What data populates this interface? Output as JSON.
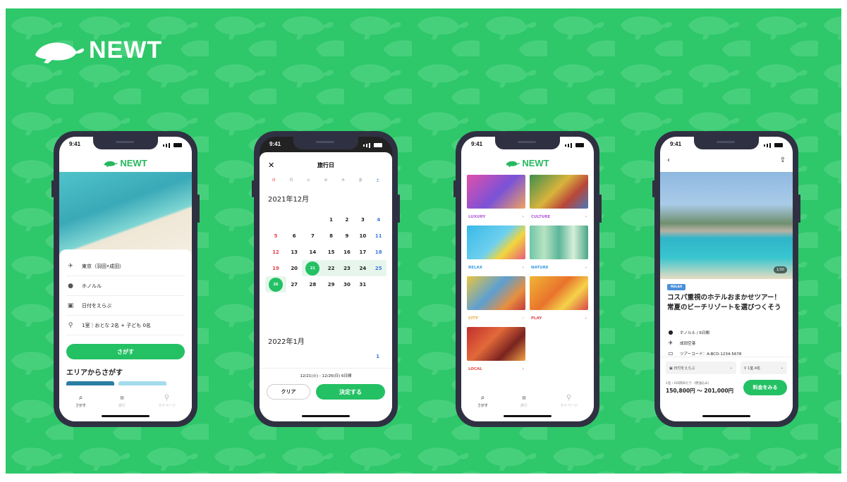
{
  "brand": {
    "name": "NEWT"
  },
  "colors": {
    "background": "#2ec76a",
    "accent": "#23c164",
    "phone_frame": "#2f3142",
    "sunday": "#e4414a",
    "saturday": "#3b7ae0"
  },
  "phone1": {
    "time": "9:41",
    "logo": "NEWT",
    "fields": [
      {
        "icon": "plane-icon",
        "text": "東京（羽田•成田）"
      },
      {
        "icon": "pin-icon",
        "text": "ホノルル"
      },
      {
        "icon": "calendar-icon",
        "text": "日付をえらぶ"
      },
      {
        "icon": "person-icon",
        "text": "1室｜おとな 2名 + 子ども 0名"
      }
    ],
    "search_button": "さがす",
    "area_title": "エリアからさがす",
    "tabs": [
      {
        "icon": "search-icon",
        "label": "さがす",
        "active": true
      },
      {
        "icon": "suitcase-icon",
        "label": "旅行",
        "active": false
      },
      {
        "icon": "user-icon",
        "label": "マイページ",
        "active": false
      }
    ]
  },
  "phone2": {
    "time": "9:41",
    "title": "旅行日",
    "close": "✕",
    "weekdays": [
      "日",
      "月",
      "火",
      "水",
      "木",
      "金",
      "土"
    ],
    "month1": "2021年12月",
    "month1_days": [
      "",
      "",
      "",
      "1",
      "2",
      "3",
      "4",
      "5",
      "6",
      "7",
      "8",
      "9",
      "10",
      "11",
      "12",
      "13",
      "14",
      "15",
      "16",
      "17",
      "18",
      "19",
      "20",
      "21",
      "22",
      "23",
      "24",
      "25",
      "26",
      "27",
      "28",
      "29",
      "30",
      "31",
      ""
    ],
    "selected_start": "21",
    "selected_end": "26",
    "month2": "2022年1月",
    "month2_days": [
      "",
      "",
      "",
      "",
      "",
      "",
      "1"
    ],
    "range_label": "12/21(火) - 12/26(日)  6日間",
    "clear_button": "クリア",
    "confirm_button": "決定する"
  },
  "phone3": {
    "time": "9:41",
    "logo": "NEWT",
    "categories": [
      {
        "label": "LUXURY",
        "color": "#b05ad6",
        "img": "linear-gradient(135deg,#e14fa9,#7a52d8 55%,#f2a25f)"
      },
      {
        "label": "CULTURE",
        "color": "#b05ad6",
        "img": "linear-gradient(135deg,#3d8f4d,#d9b33d 45%,#b94639 70%,#4b77b8)"
      },
      {
        "label": "RELAX",
        "color": "#3b9de0",
        "img": "linear-gradient(135deg,#39b9e8,#6ed0ee 50%,#f2d63c 70%,#e85a7e)"
      },
      {
        "label": "NATURE",
        "color": "#3b9de0",
        "img": "linear-gradient(90deg,#6fc6a8,#b9e3c2 25%,#5bb59a 50%,#d6efd9 75%,#4aa587)"
      },
      {
        "label": "CITY",
        "color": "#e8a830",
        "img": "linear-gradient(135deg,#e8c542,#5d9fd1 45%,#e88f3e 75%,#c2393b)"
      },
      {
        "label": "PLAY",
        "color": "#e24b4b",
        "img": "linear-gradient(135deg,#f0b535,#e9732c 45%,#f5d24a 70%,#d84747)"
      },
      {
        "label": "LOCAL",
        "color": "#e24b4b",
        "img": "linear-gradient(135deg,#c22f2f,#e2693a 40%,#7a2320 70%,#f0a144)"
      }
    ],
    "tabs": [
      {
        "icon": "search-icon",
        "label": "さがす",
        "active": true
      },
      {
        "icon": "suitcase-icon",
        "label": "旅行",
        "active": false
      },
      {
        "icon": "user-icon",
        "label": "マイページ",
        "active": false
      }
    ]
  },
  "phone4": {
    "time": "9:41",
    "photo_count": "1/30",
    "tag": "RELAX",
    "title": "コスパ重視のホテルおまかせツアー！常夏のビーチリゾートを選びつくそう",
    "meta": [
      {
        "icon": "pin-icon",
        "text": "ホノルル / 6日間"
      },
      {
        "icon": "plane-icon",
        "text": "成田空港"
      },
      {
        "icon": "code-icon",
        "text": "ツアーコード：A-BCD-1234-5678"
      }
    ],
    "date_select": "日付をえらぶ",
    "people_select": "1室,4名",
    "price_note": "1名・6日間あたり（燃油込み）",
    "price": "150,800円 〜 201,000円",
    "price_button": "料金をみる"
  }
}
